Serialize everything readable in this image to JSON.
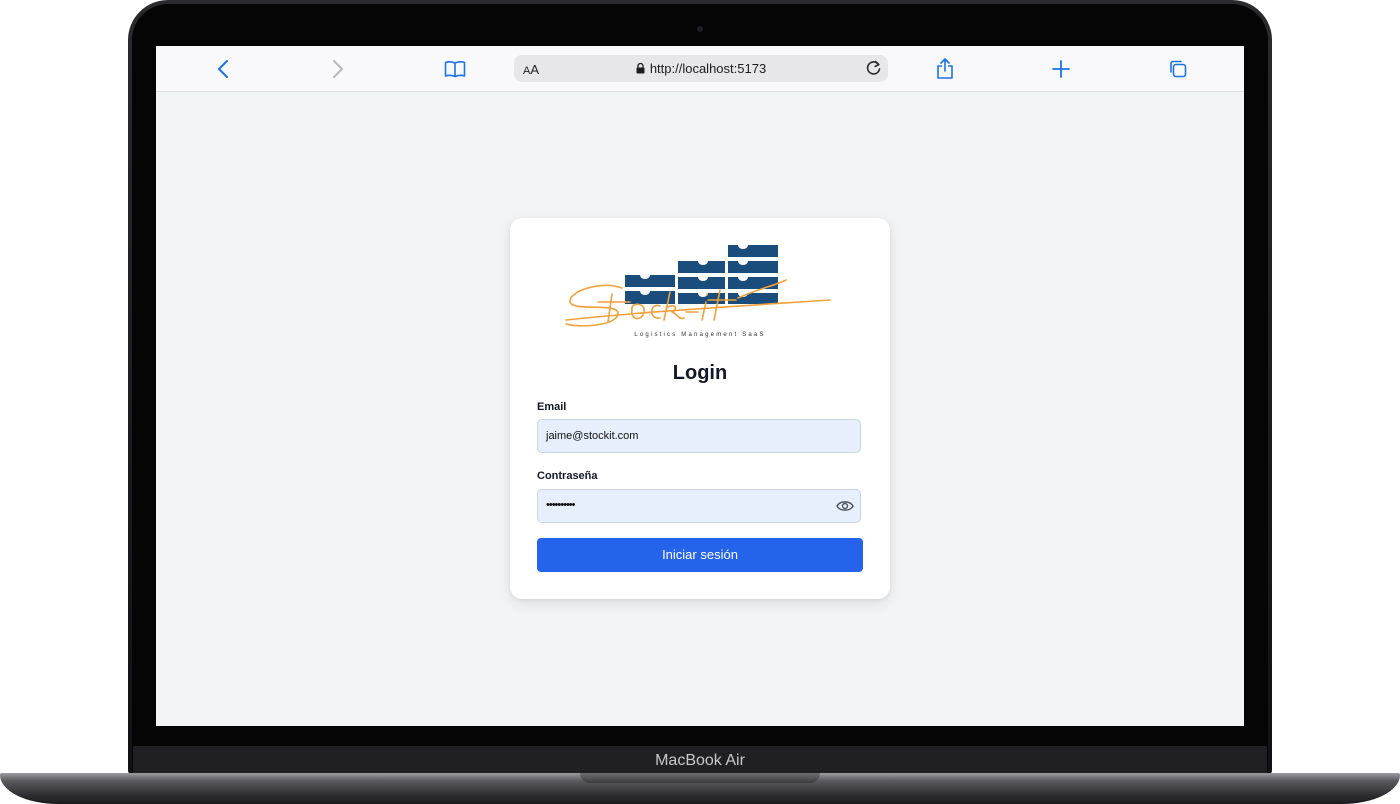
{
  "device": {
    "label": "MacBook Air"
  },
  "browser": {
    "text_size_button": "AA",
    "url": "http://localhost:5173"
  },
  "logo": {
    "wordmark": "Stock-it",
    "tagline": "Logistics Management SaaS"
  },
  "login": {
    "title": "Login",
    "email_label": "Email",
    "email_value": "jaime@stockit.com",
    "password_label": "Contraseña",
    "password_value": "••••••••••",
    "submit_label": "Iniciar sesión"
  },
  "colors": {
    "primary": "#2563eb",
    "logo_blue": "#1a4d7c",
    "logo_orange": "#f2a03a",
    "input_bg": "#e8effc",
    "page_bg": "#f3f4f6"
  }
}
